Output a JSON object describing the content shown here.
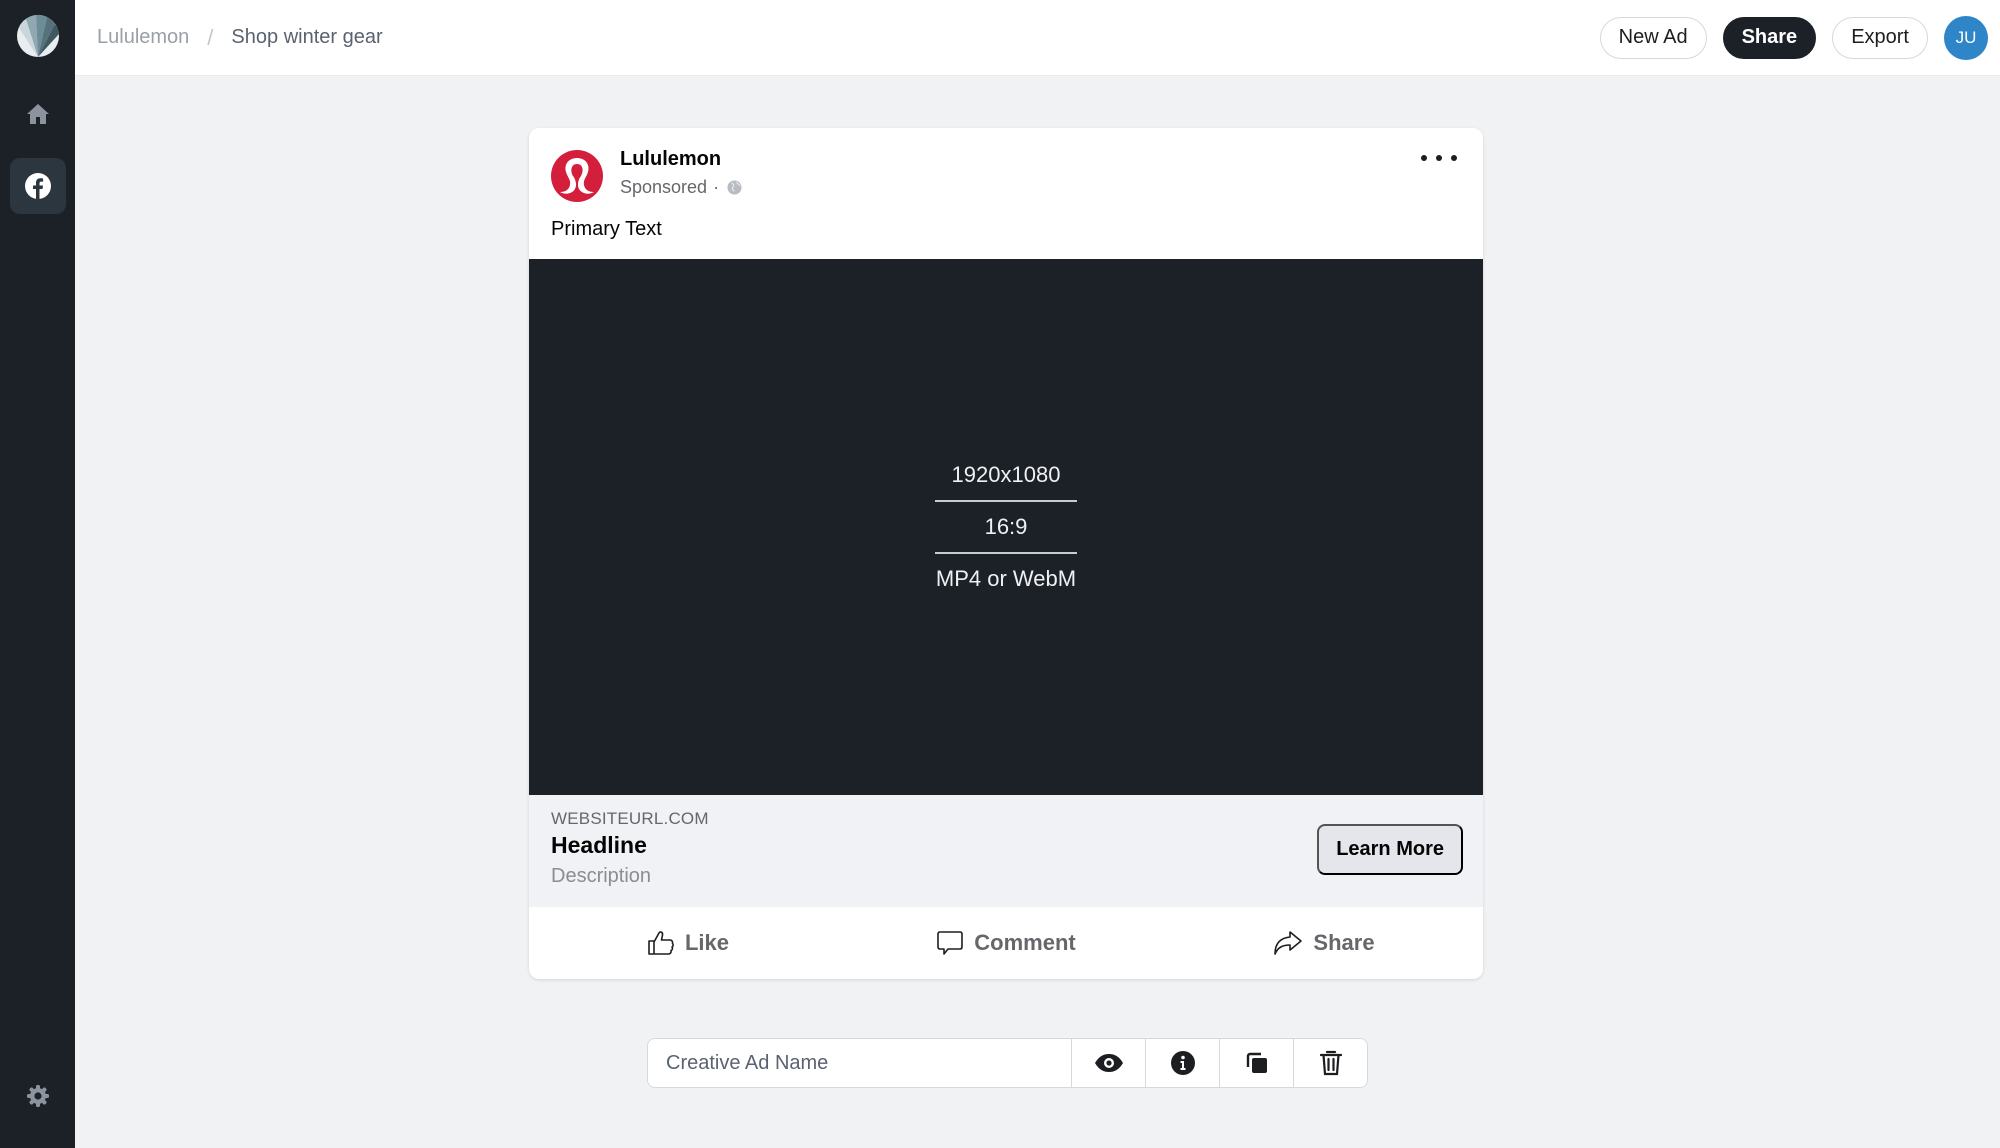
{
  "sidebar": {
    "logo_icon": "shell-fan-logo",
    "items": [
      {
        "name": "home",
        "icon": "home-icon"
      },
      {
        "name": "facebook",
        "icon": "facebook-icon",
        "active": true
      }
    ],
    "settings_icon": "gear-icon"
  },
  "header": {
    "breadcrumb": {
      "root": "Lululemon",
      "separator": "/",
      "current": "Shop winter gear"
    },
    "buttons": {
      "new_ad": "New Ad",
      "share": "Share",
      "export": "Export"
    },
    "avatar_initials": "JU",
    "avatar_color": "#2e85c8"
  },
  "ad": {
    "brand_name": "Lululemon",
    "sponsored_label": "Sponsored",
    "sponsored_separator": "·",
    "brand_color": "#d31f3c",
    "primary_text": "Primary Text",
    "media": {
      "resolution": "1920x1080",
      "aspect_ratio": "16:9",
      "formats": "MP4 or WebM"
    },
    "link": {
      "website": "WEBSITEURL.COM",
      "headline": "Headline",
      "description": "Description",
      "cta": "Learn More"
    },
    "actions": {
      "like": "Like",
      "comment": "Comment",
      "share": "Share"
    }
  },
  "toolbar": {
    "name_placeholder": "Creative Ad Name",
    "name_value": "",
    "tools": [
      "eye-icon",
      "info-icon",
      "duplicate-icon",
      "trash-icon"
    ]
  }
}
